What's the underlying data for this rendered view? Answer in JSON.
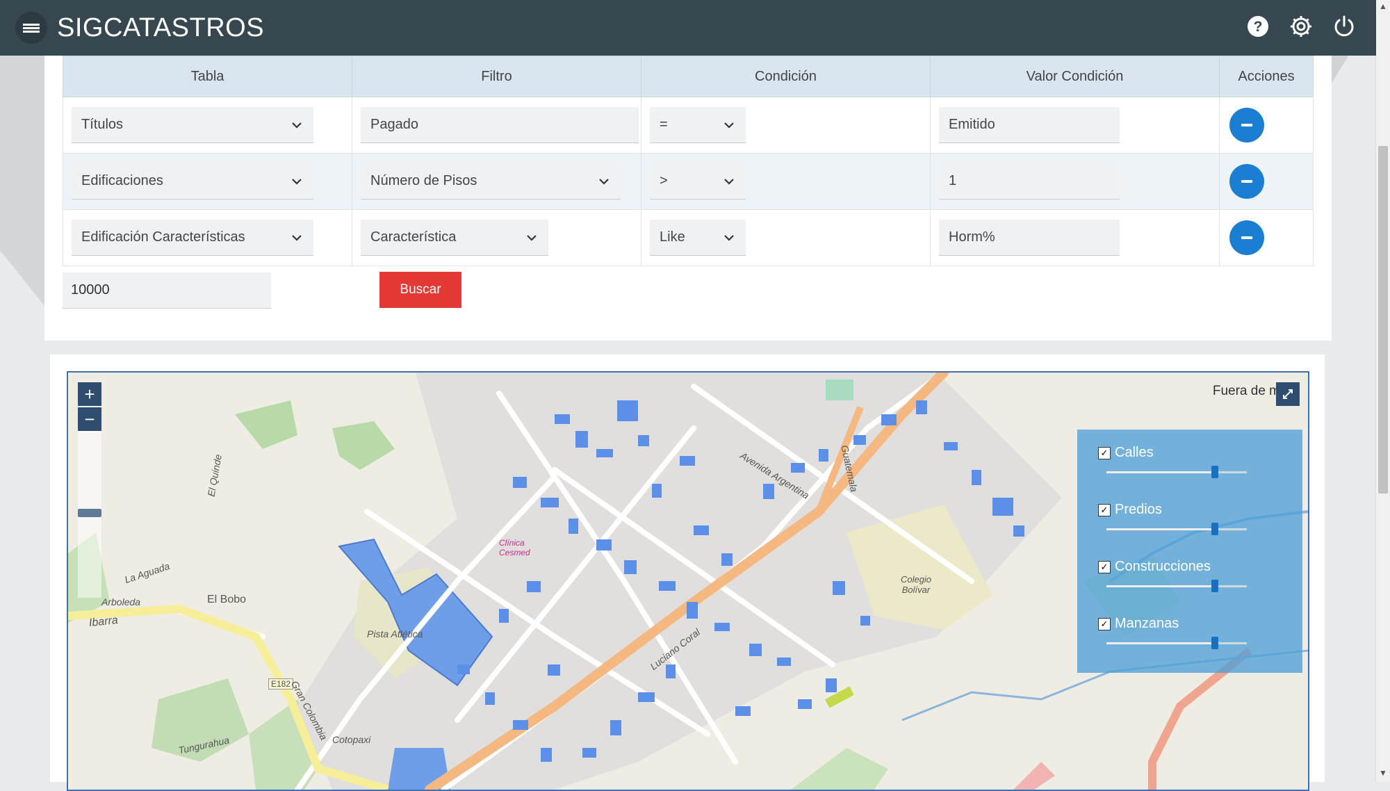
{
  "app": {
    "title": "SIGCATASTROS"
  },
  "topbar": {
    "icons": [
      "menu-icon",
      "help-icon",
      "settings-icon",
      "power-icon"
    ]
  },
  "table": {
    "headers": [
      "Tabla",
      "Filtro",
      "Condición",
      "Valor Condición",
      "Acciones"
    ],
    "rows": [
      {
        "tabla": "Títulos",
        "filtro": "Pagado",
        "filtro_dropdown": false,
        "condicion": "=",
        "valor": "Emitido"
      },
      {
        "tabla": "Edificaciones",
        "filtro": "Número de Pisos",
        "filtro_dropdown": true,
        "condicion": ">",
        "valor": "1"
      },
      {
        "tabla": "Edificación Características",
        "filtro": "Característica",
        "filtro_dropdown": true,
        "condicion": "Like",
        "valor": "Horm%"
      }
    ]
  },
  "limit": {
    "value": "10000"
  },
  "search": {
    "label": "Buscar",
    "color": "#e53935"
  },
  "map": {
    "mouse_position": "Fuera de m",
    "layers": [
      {
        "name": "Calles",
        "checked": true,
        "opacity": 1.0
      },
      {
        "name": "Predios",
        "checked": true,
        "opacity": 1.0
      },
      {
        "name": "Construcciones",
        "checked": true,
        "opacity": 1.0
      },
      {
        "name": "Manzanas",
        "checked": true,
        "opacity": 1.0
      }
    ],
    "labels": [
      "El Bobo",
      "Pista Atlética",
      "Colegio Bolívar",
      "Clínica Cesmed",
      "E182",
      "La Aguada",
      "Arboleda",
      "Tungurahua",
      "Gran Colombia",
      "Cotopaxi",
      "Luciano Coral",
      "Avenida Argentina",
      "Guatemala",
      "Ibarra",
      "El Quinde"
    ]
  },
  "colors": {
    "topbar": "#37474f",
    "accent": "#1a7fd3",
    "building": "#5b8fe8",
    "layer_panel": "#50a0d7"
  }
}
